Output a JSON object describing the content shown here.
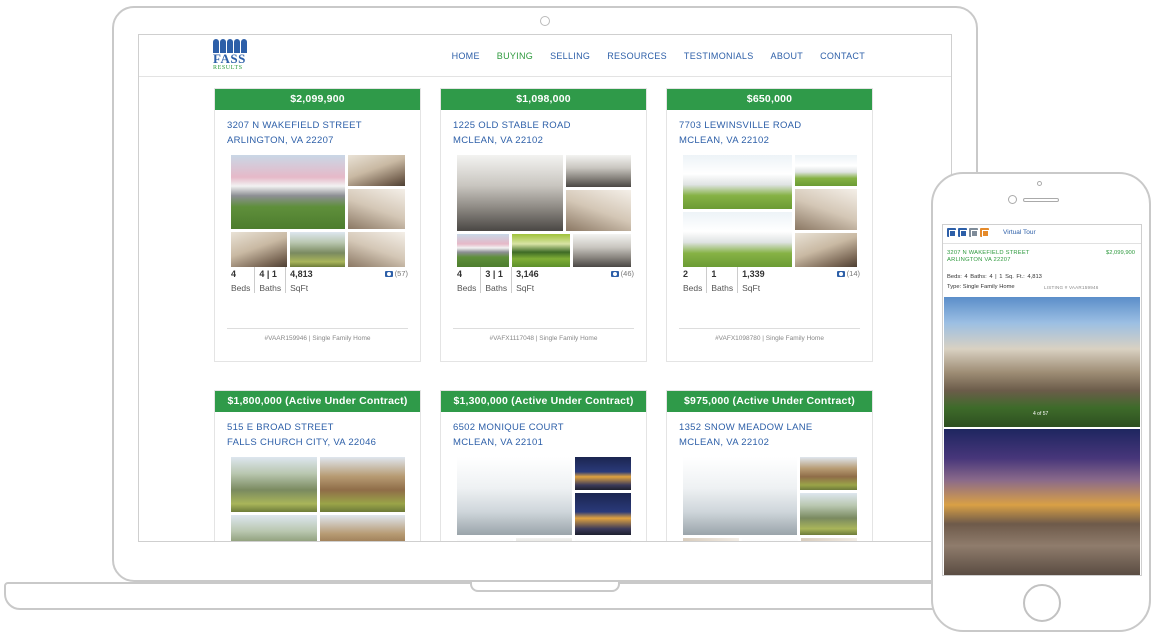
{
  "site": {
    "logo": {
      "name": "FASS",
      "sub": "RESULTS"
    },
    "nav": [
      "HOME",
      "BUYING",
      "SELLING",
      "RESOURCES",
      "TESTIMONIALS",
      "ABOUT",
      "CONTACT"
    ],
    "active_nav": "BUYING"
  },
  "listings": [
    {
      "price": "$2,099,900",
      "street": "3207 N WAKEFIELD STREET",
      "city": "ARLINGTON, VA 22207",
      "beds": "4",
      "baths": "4 | 1",
      "sqft": "4,813",
      "photo_count": "(57)",
      "mls": "#VAAR159946 | Single Family Home"
    },
    {
      "price": "$1,098,000",
      "street": "1225 OLD STABLE ROAD",
      "city": "MCLEAN, VA 22102",
      "beds": "4",
      "baths": "3 | 1",
      "sqft": "3,146",
      "photo_count": "(46)",
      "mls": "#VAFX1117048 | Single Family Home"
    },
    {
      "price": "$650,000",
      "street": "7703 LEWINSVILLE ROAD",
      "city": "MCLEAN, VA 22102",
      "beds": "2",
      "baths": "1",
      "sqft": "1,339",
      "photo_count": "(14)",
      "mls": "#VAFX1098780 | Single Family Home"
    },
    {
      "price": "$1,800,000 (Active Under Contract)",
      "street": "515 E BROAD STREET",
      "city": "FALLS CHURCH CITY, VA 22046"
    },
    {
      "price": "$1,300,000 (Active Under Contract)",
      "street": "6502 MONIQUE COURT",
      "city": "MCLEAN, VA 22101"
    },
    {
      "price": "$975,000 (Active Under Contract)",
      "street": "1352 SNOW MEADOW LANE",
      "city": "MCLEAN, VA 22102"
    }
  ],
  "stat_labels": {
    "beds": "Beds",
    "baths": "Baths",
    "sqft": "SqFt"
  },
  "mobile": {
    "virtual_tour": "Virtual Tour",
    "street": "3207 N WAKEFIELD STREET",
    "city": "ARLINGTON VA 22207",
    "price": "$2,099,900",
    "beds_baths": "Beds: 4   Baths: 4 | 1   Sq. Ft.: 4,813",
    "type": "Type: Single Family Home",
    "listing": "LISTING # VAAR159946",
    "photo_counter": "4 of 57"
  },
  "colors": {
    "brand_blue": "#2d5fa8",
    "brand_green": "#2f9a49"
  }
}
